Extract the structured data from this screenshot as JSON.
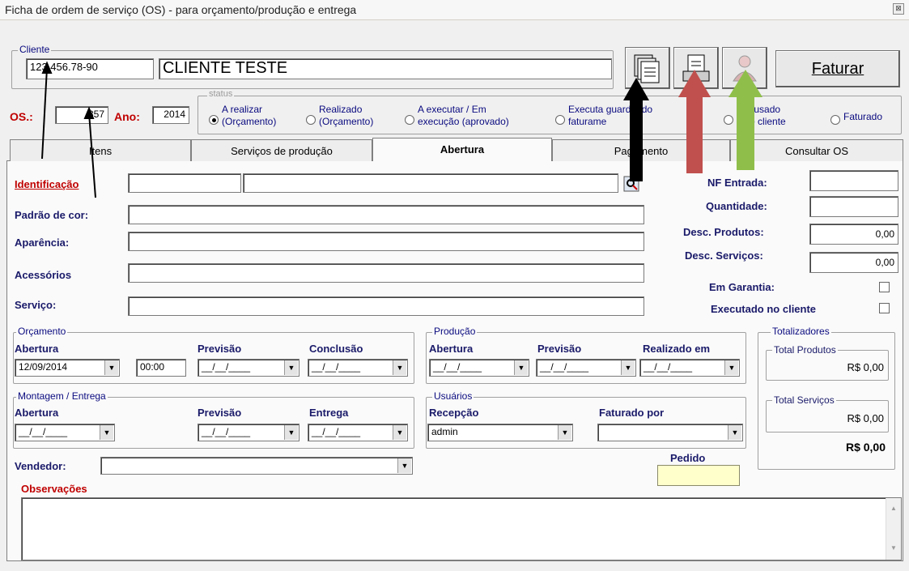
{
  "window": {
    "title": "Ficha de ordem de serviço (OS) - para orçamento/produção e entrega",
    "close": "⊠"
  },
  "client": {
    "group_label": "Cliente",
    "id_value": "123.456.78-90",
    "name_value": "CLIENTE TESTE"
  },
  "toolbar": {
    "faturar_label": "Faturar"
  },
  "os": {
    "os_label": "OS.:",
    "os_value": "357",
    "ano_label": "Ano:",
    "ano_value": "2014"
  },
  "status": {
    "group_label": "status",
    "options": [
      {
        "line1": "A realizar",
        "line2": "(Orçamento)"
      },
      {
        "line1": "Realizado",
        "line2": "(Orçamento)"
      },
      {
        "line1": "A executar / Em",
        "line2": "execução (aprovado)"
      },
      {
        "line1": "Executa guardando",
        "line2": "faturame"
      },
      {
        "line1": "Recusado",
        "line2": "pelo cliente"
      },
      {
        "line1": "Faturado",
        "line2": ""
      }
    ]
  },
  "tabs": [
    "Itens",
    "Serviços de produção",
    "Abertura",
    "Pagamento",
    "Consultar OS"
  ],
  "form": {
    "identificacao": "Identificação",
    "padrao": "Padrão de cor:",
    "aparencia": "Aparência:",
    "acessorios": "Acessórios",
    "servico": "Serviço:"
  },
  "right_panel": {
    "nf_entrada": "NF Entrada:",
    "quantidade": "Quantidade:",
    "desc_produtos": "Desc. Produtos:",
    "desc_produtos_value": "0,00",
    "desc_servicos": "Desc. Serviços:",
    "desc_servicos_value": "0,00",
    "em_garantia": "Em Garantia:",
    "executado_cliente": "Executado no cliente"
  },
  "orcamento": {
    "group_label": "Orçamento",
    "abertura": "Abertura",
    "previsao": "Previsão",
    "conclusao": "Conclusão",
    "abertura_date": "12/09/2014",
    "abertura_time": "00:00",
    "empty_date": "__/__/____"
  },
  "producao": {
    "group_label": "Produção",
    "abertura": "Abertura",
    "previsao": "Previsão",
    "realizado": "Realizado em"
  },
  "montagem": {
    "group_label": "Montagem / Entrega",
    "abertura": "Abertura",
    "previsao": "Previsão",
    "entrega": "Entrega"
  },
  "usuarios": {
    "group_label": "Usuários",
    "recepcao": "Recepção",
    "recepcao_value": "admin",
    "faturado_por": "Faturado por"
  },
  "totalizadores": {
    "group_label": "Totalizadores",
    "total_produtos_label": "Total Produtos",
    "total_produtos_value": "R$ 0,00",
    "total_servicos_label": "Total Serviços",
    "total_servicos_value": "R$ 0,00",
    "grand_total": "R$ 0,00"
  },
  "vendedor": "Vendedor:",
  "pedido": "Pedido",
  "observacoes": "Observações",
  "colors": {
    "accent_red": "#c00000",
    "label_blue": "#0a0a80",
    "arrow_red": "#c0504d",
    "arrow_green": "#8fbf4a",
    "pedido_bg": "#ffffcc"
  }
}
